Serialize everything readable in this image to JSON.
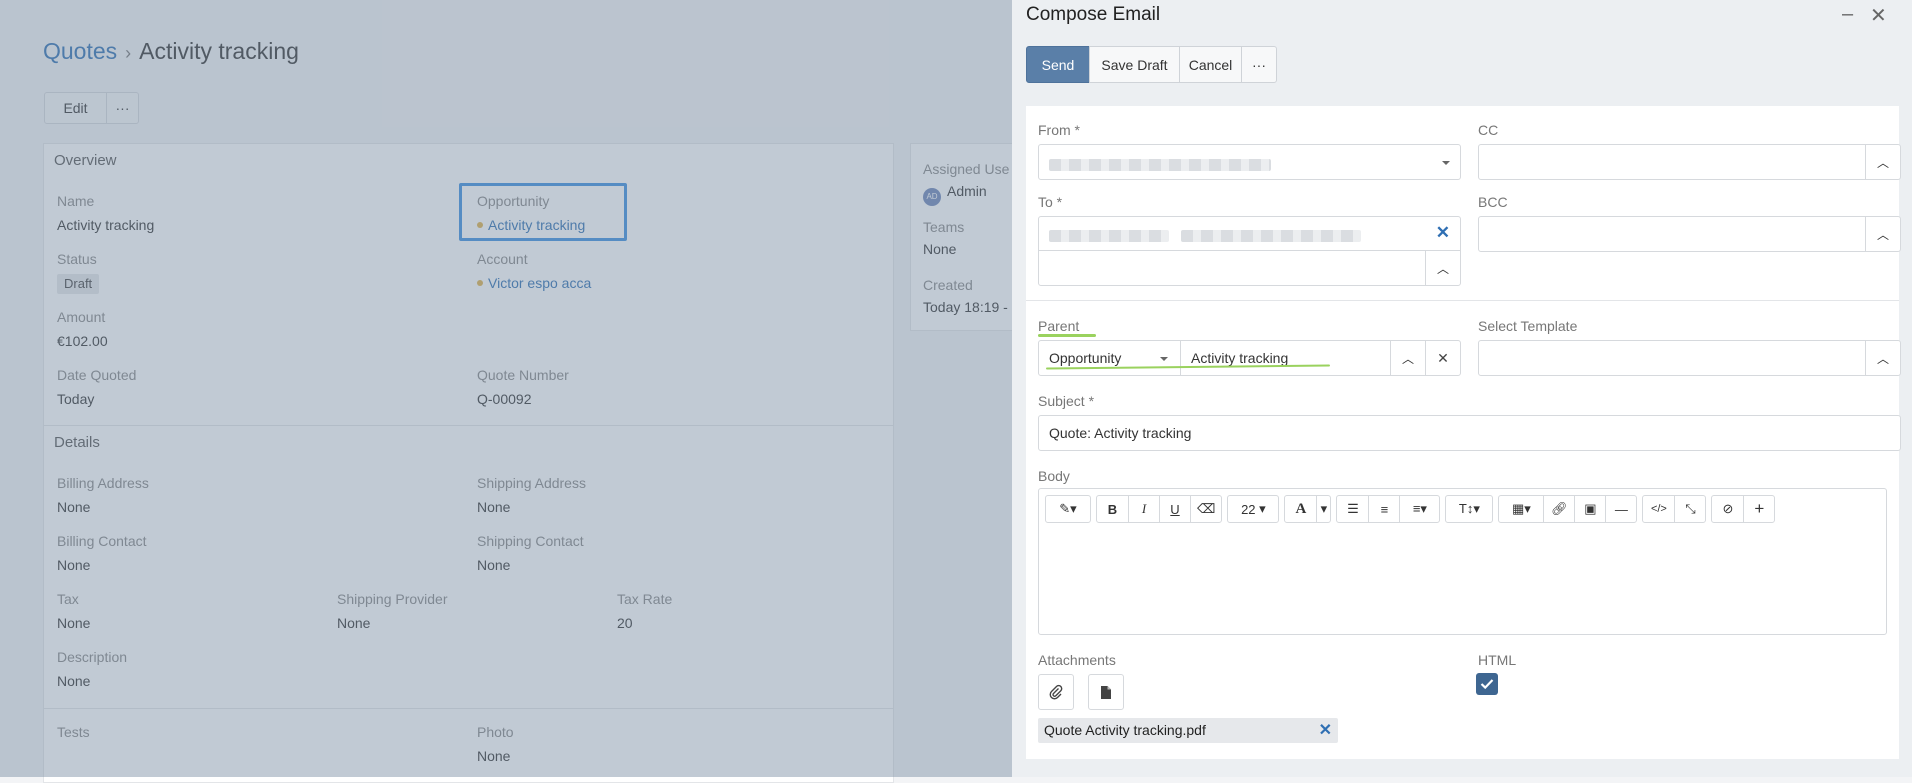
{
  "record": {
    "breadcrumb": {
      "parent": "Quotes",
      "separator": "›",
      "current": "Activity tracking"
    },
    "actions": {
      "edit_label": "Edit",
      "more_label": "···"
    },
    "overview": {
      "heading": "Overview",
      "name": {
        "label": "Name",
        "value": "Activity tracking"
      },
      "opportunity": {
        "label": "Opportunity",
        "value": "Activity tracking"
      },
      "status": {
        "label": "Status",
        "value": "Draft"
      },
      "account": {
        "label": "Account",
        "value": "Victor espo acca"
      },
      "amount": {
        "label": "Amount",
        "value": "€102.00"
      },
      "date_quoted": {
        "label": "Date Quoted",
        "value": "Today"
      },
      "quote_number": {
        "label": "Quote Number",
        "value": "Q-00092"
      }
    },
    "details": {
      "heading": "Details",
      "billing_address": {
        "label": "Billing Address",
        "value": "None"
      },
      "shipping_address": {
        "label": "Shipping Address",
        "value": "None"
      },
      "billing_contact": {
        "label": "Billing Contact",
        "value": "None"
      },
      "shipping_contact": {
        "label": "Shipping Contact",
        "value": "None"
      },
      "tax": {
        "label": "Tax",
        "value": "None"
      },
      "shipping_provider": {
        "label": "Shipping Provider",
        "value": "None"
      },
      "tax_rate": {
        "label": "Tax Rate",
        "value": "20"
      },
      "description": {
        "label": "Description",
        "value": "None"
      }
    },
    "extra": {
      "tests": {
        "label": "Tests"
      },
      "photo": {
        "label": "Photo",
        "value": "None"
      }
    },
    "side": {
      "assigned_user": {
        "label": "Assigned Use",
        "value": "Admin",
        "avatar": "AD"
      },
      "teams": {
        "label": "Teams",
        "value": "None"
      },
      "created": {
        "label": "Created",
        "value": "Today 18:19 -"
      }
    }
  },
  "compose": {
    "title": "Compose Email",
    "minimize_icon": "minimize-icon",
    "close_icon": "close-icon",
    "buttons": {
      "send": "Send",
      "save_draft": "Save Draft",
      "cancel": "Cancel",
      "more": "···"
    },
    "fields": {
      "from": {
        "label": "From *"
      },
      "cc": {
        "label": "CC"
      },
      "to": {
        "label": "To *"
      },
      "bcc": {
        "label": "BCC"
      },
      "parent": {
        "label": "Parent",
        "type_value": "Opportunity",
        "record_value": "Activity tracking"
      },
      "select_template": {
        "label": "Select Template"
      },
      "subject": {
        "label": "Subject *",
        "value": "Quote: Activity tracking"
      },
      "body": {
        "label": "Body"
      }
    },
    "toolbar": {
      "font_size": "22"
    },
    "attachments": {
      "label": "Attachments",
      "file": "Quote Activity tracking.pdf"
    },
    "html": {
      "label": "HTML",
      "checked": true
    }
  },
  "colors": {
    "primary": "#5a7fa8",
    "link": "#2f6fb3",
    "highlight": "#3b8fe0",
    "annotation_green": "#9ad25e",
    "checkbox": "#3e6691"
  }
}
